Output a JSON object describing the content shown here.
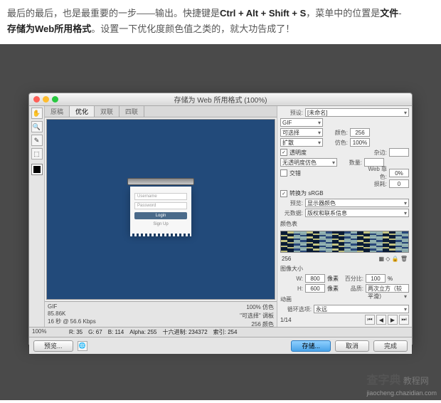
{
  "article": {
    "line1_pre": "最后的最后，也是最重要的一步——输出。快捷键是",
    "shortcut": "Ctrl + Alt + Shift + S",
    "line1_mid": "，菜单中的位置是",
    "menu1": "文件",
    "sep": "-",
    "menu2": "存储为Web所用格式",
    "line2": "。设置一下优化度颜色值之类的，就大功告成了！"
  },
  "dialog": {
    "title": "存储为 Web 所用格式 (100%)",
    "tabs": [
      "原稿",
      "优化",
      "双联",
      "四联"
    ],
    "active_tab": 1,
    "tools": [
      "✋",
      "🔍",
      "✎",
      "⬚"
    ],
    "preview": {
      "username_ph": "Username",
      "password_ph": "Password",
      "login": "Login",
      "signup": "Sign Up"
    },
    "info_left": {
      "fmt": "GIF",
      "size": "85.86K",
      "speed": "16 秒 @ 56.6 Kbps"
    },
    "info_right": {
      "l1": "100% 仿色",
      "l2": "\"可选择\" 调板",
      "l3": "256 颜色"
    },
    "status": {
      "r": "R: 35",
      "g": "G: 67",
      "b": "B: 114",
      "alpha": "Alpha: 255",
      "hex": "十六进制: 234372",
      "idx": "索引: 254"
    },
    "status_left": "100%",
    "preview_label": "预览...",
    "right": {
      "preset_lbl": "预设:",
      "preset_val": "[未命名]",
      "format": "GIF",
      "algo": "可选择",
      "colors_lbl": "颜色:",
      "colors": "256",
      "dither": "扩散",
      "dither_lbl": "仿色:",
      "dither_v": "100%",
      "trans_chk": "✓",
      "trans": "透明度",
      "matte_lbl": "杂边:",
      "trans_dither": "无透明度仿色",
      "amt_lbl": "数量:",
      "inter_chk": "",
      "inter": "交错",
      "web_lbl": "Web 靠色:",
      "web_v": "0%",
      "loss_lbl": "损耗:",
      "loss_v": "0",
      "srgb_chk": "✓",
      "srgb": "转换为 sRGB",
      "preview_lbl": "预览:",
      "preview_v": "显示器颜色",
      "meta_lbl": "元数据:",
      "meta_v": "版权和联系信息",
      "table_lbl": "颜色表",
      "table_count": "256",
      "imgsize_lbl": "图像大小",
      "w_lbl": "W:",
      "w": "800",
      "h_lbl": "H:",
      "h": "600",
      "px": "像素",
      "pct_lbl": "百分比:",
      "pct": "100",
      "pct_unit": "%",
      "quality_lbl": "品质:",
      "quality": "两次立方（较平滑）",
      "anim_lbl": "动画",
      "loop_lbl": "循环选项:",
      "loop": "永远",
      "frame": "1/14",
      "nav": [
        "⏮",
        "◀",
        "▶",
        "⏭"
      ]
    },
    "buttons": {
      "save": "存储...",
      "cancel": "取消",
      "done": "完成"
    }
  },
  "watermark": {
    "brand": "查字典",
    "sub": "教程网",
    "url": "jiaocheng.chazidian.com"
  }
}
